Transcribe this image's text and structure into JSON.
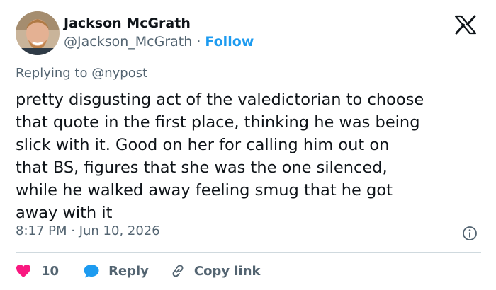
{
  "author": {
    "name": "Jackson McGrath",
    "handle": "@Jackson_McGrath",
    "separator": "·",
    "follow_label": "Follow"
  },
  "tweet": {
    "replying_prefix": "Replying to ",
    "replying_handle": "@nypost",
    "text_lines": [
      "pretty disgusting act of the valedictorian to choose",
      "that quote in the first place, thinking he was being",
      "slick with it. Good on her for calling him out on",
      "that BS, figures that she was the one silenced,",
      "while he walked away feeling smug that he got",
      "away with it"
    ],
    "timestamp": "8:17 PM · Jun 10, 2026"
  },
  "actions": {
    "like_count": "10",
    "reply_label": "Reply",
    "copy_label": "Copy link"
  },
  "icons": {
    "brand": "x-logo",
    "info": "info-icon",
    "like": "heart-icon",
    "reply": "speech-bubble-icon",
    "copy": "link-icon"
  },
  "colors": {
    "like": "#f91880",
    "reply": "#1d9bf0",
    "follow": "#1d9bf0",
    "muted": "#536471"
  }
}
